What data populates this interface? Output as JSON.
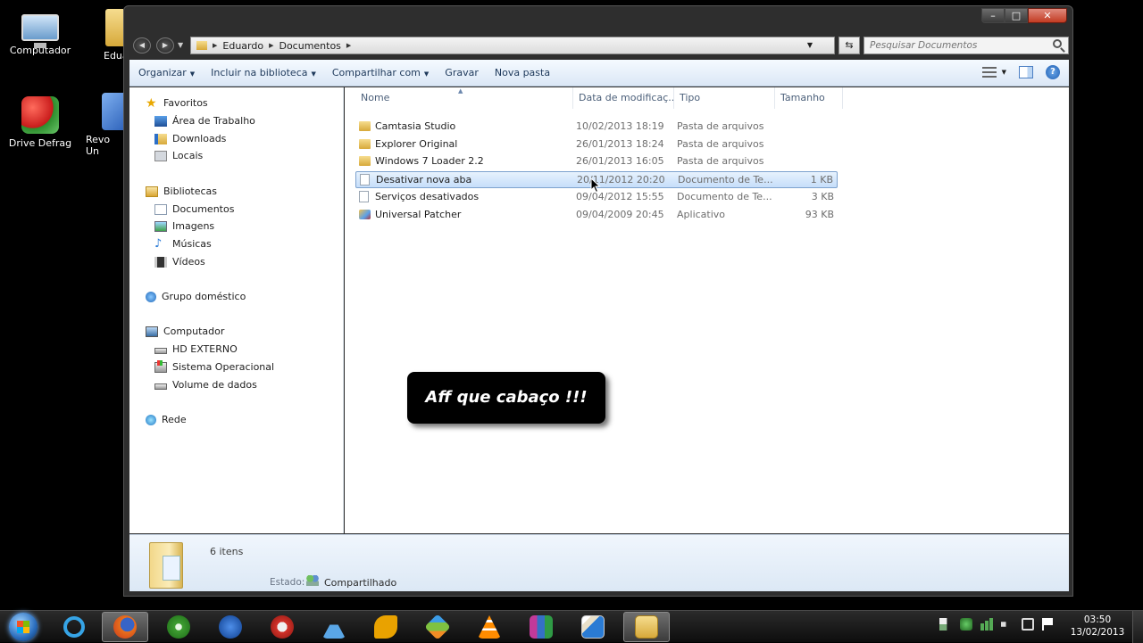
{
  "desktop": {
    "icons": [
      {
        "label": "Computador"
      },
      {
        "label": "Edua"
      },
      {
        "label": "Drive Defrag"
      },
      {
        "label": "Revo Un"
      }
    ]
  },
  "window": {
    "controls": {
      "minimize": "–",
      "maximize": "□",
      "close": "✕"
    },
    "address": {
      "crumbs": [
        "Eduardo",
        "Documentos"
      ]
    },
    "search": {
      "placeholder": "Pesquisar Documentos"
    },
    "toolbar": {
      "organize": "Organizar",
      "include_library": "Incluir na biblioteca",
      "share": "Compartilhar com",
      "burn": "Gravar",
      "new_folder": "Nova pasta"
    }
  },
  "navpane": {
    "favorites": {
      "label": "Favoritos",
      "items": [
        "Área de Trabalho",
        "Downloads",
        "Locais"
      ]
    },
    "libraries": {
      "label": "Bibliotecas",
      "items": [
        "Documentos",
        "Imagens",
        "Músicas",
        "Vídeos"
      ]
    },
    "homegroup": {
      "label": "Grupo doméstico"
    },
    "computer": {
      "label": "Computador",
      "items": [
        "HD EXTERNO",
        "Sistema Operacional",
        "Volume de dados"
      ]
    },
    "network": {
      "label": "Rede"
    }
  },
  "filelist": {
    "columns": {
      "name": "Nome",
      "date": "Data de modificaç...",
      "type": "Tipo",
      "size": "Tamanho"
    },
    "rows": [
      {
        "name": "Camtasia Studio",
        "date": "10/02/2013 18:19",
        "type": "Pasta de arquivos",
        "size": "",
        "icon": "folder-icon"
      },
      {
        "name": "Explorer Original",
        "date": "26/01/2013 18:24",
        "type": "Pasta de arquivos",
        "size": "",
        "icon": "folder-icon"
      },
      {
        "name": "Windows 7 Loader 2.2",
        "date": "26/01/2013 16:05",
        "type": "Pasta de arquivos",
        "size": "",
        "icon": "folder-icon"
      },
      {
        "name": "Desativar nova aba",
        "date": "20/11/2012 20:20",
        "type": "Documento de Te...",
        "size": "1 KB",
        "icon": "text-file-icon",
        "selected": true
      },
      {
        "name": "Serviços desativados",
        "date": "09/04/2012 15:55",
        "type": "Documento de Te...",
        "size": "3 KB",
        "icon": "text-file-icon"
      },
      {
        "name": "Universal Patcher",
        "date": "09/04/2009 20:45",
        "type": "Aplicativo",
        "size": "93 KB",
        "icon": "application-icon"
      }
    ]
  },
  "caption": {
    "text": "Aff que cabaço !!!"
  },
  "details": {
    "count": "6 itens",
    "state_label": "Estado:",
    "state_value": "Compartilhado"
  },
  "taskbar": {
    "apps": [
      "internet-explorer-icon",
      "firefox-icon",
      "utorrent-icon",
      "bolt-app-icon",
      "ccleaner-icon",
      "flask-app-icon",
      "key-app-icon",
      "cube-app-icon",
      "vlc-icon",
      "winrar-icon",
      "flash-app-icon",
      "windows-explorer-icon"
    ],
    "clock": {
      "time": "03:50",
      "date": "13/02/2013"
    }
  }
}
